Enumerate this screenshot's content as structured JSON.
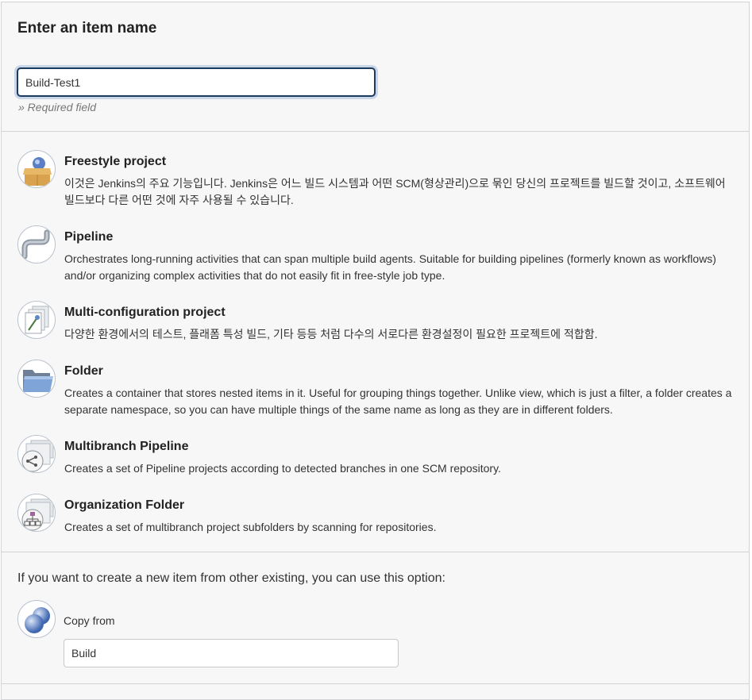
{
  "header": {
    "title": "Enter an item name",
    "name_input_value": "Build-Test1",
    "required_note": "» Required field"
  },
  "item_types": [
    {
      "label": "Freestyle project",
      "icon": "freestyle-box-icon",
      "description": "이것은 Jenkins의 주요 기능입니다. Jenkins은 어느 빌드 시스템과 어떤 SCM(형상관리)으로 묶인 당신의 프로젝트를 빌드할 것이고, 소프트웨어 빌드보다 다른 어떤 것에 자주 사용될 수 있습니다."
    },
    {
      "label": "Pipeline",
      "icon": "pipeline-pipe-icon",
      "description": "Orchestrates long-running activities that can span multiple build agents. Suitable for building pipelines (formerly known as workflows) and/or organizing complex activities that do not easily fit in free-style job type."
    },
    {
      "label": "Multi-configuration project",
      "icon": "multi-config-icon",
      "description": "다양한 환경에서의 테스트, 플래폼 특성 빌드, 기타 등등 처럼 다수의 서로다른 환경설정이 필요한 프로젝트에 적합함."
    },
    {
      "label": "Folder",
      "icon": "folder-icon",
      "description": "Creates a container that stores nested items in it. Useful for grouping things together. Unlike view, which is just a filter, a folder creates a separate namespace, so you can have multiple things of the same name as long as they are in different folders."
    },
    {
      "label": "Multibranch Pipeline",
      "icon": "multibranch-pipeline-icon",
      "description": "Creates a set of Pipeline projects according to detected branches in one SCM repository."
    },
    {
      "label": "Organization Folder",
      "icon": "organization-folder-icon",
      "description": "Creates a set of multibranch project subfolders by scanning for repositories."
    }
  ],
  "copy": {
    "intro": "If you want to create a new item from other existing, you can use this option:",
    "icon": "copy-spheres-icon",
    "label": "Copy from",
    "input_value": "Build"
  }
}
